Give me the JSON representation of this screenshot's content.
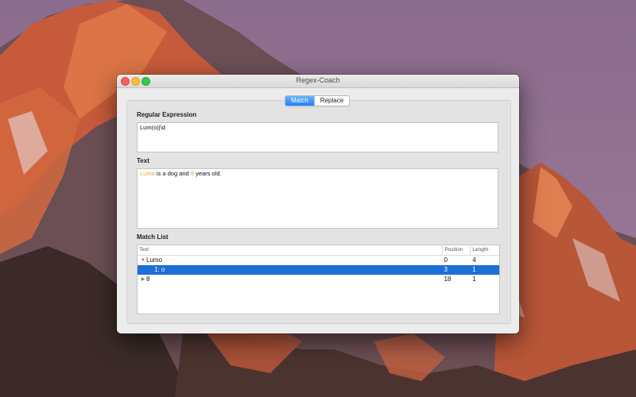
{
  "window": {
    "title": "Regex-Coach"
  },
  "tabs": [
    {
      "label": "Match",
      "active": true
    },
    {
      "label": "Replace",
      "active": false
    }
  ],
  "regex": {
    "label": "Regular Expression",
    "value": "Lum(o)|\\d"
  },
  "text": {
    "label": "Text",
    "segments": [
      {
        "text": "Lumo",
        "highlight": true
      },
      {
        "text": " is a dog and ",
        "highlight": false
      },
      {
        "text": "8",
        "highlight": true
      },
      {
        "text": " years old.",
        "highlight": false
      }
    ]
  },
  "match_list": {
    "label": "Match List",
    "columns": [
      "Text",
      "Position",
      "Length"
    ],
    "rows": [
      {
        "text": "Lumo",
        "disclosure": "expanded",
        "indent": 0,
        "position": "0",
        "length": "4",
        "selected": false
      },
      {
        "text": "1: o",
        "disclosure": "none",
        "indent": 1,
        "position": "3",
        "length": "1",
        "selected": true
      },
      {
        "text": "8",
        "disclosure": "collapsed",
        "indent": 0,
        "position": "18",
        "length": "1",
        "selected": false
      }
    ]
  },
  "colors": {
    "accent": "#1b6fd6",
    "highlight": "#f0a040",
    "traffic_close": "#fc605c",
    "traffic_minimize": "#fdbc40",
    "traffic_maximize": "#34c84a"
  }
}
